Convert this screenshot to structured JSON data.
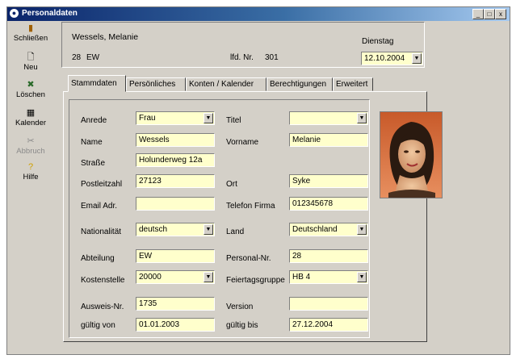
{
  "window": {
    "title": "Personaldaten",
    "buttons": [
      "_",
      "□",
      "x"
    ]
  },
  "toolbar": [
    {
      "label": "Schließen",
      "icon": "door-icon",
      "glyph": "▮",
      "color": "#a06000",
      "enabled": true
    },
    {
      "label": "Neu",
      "icon": "new-document-icon",
      "glyph": "🗋",
      "color": "#000000",
      "enabled": true
    },
    {
      "label": "Löschen",
      "icon": "delete-icon",
      "glyph": "✖",
      "color": "#2a6a2a",
      "enabled": true
    },
    {
      "label": "Kalender",
      "icon": "calendar-icon",
      "glyph": "▦",
      "color": "#000000",
      "enabled": true
    },
    {
      "label": "Abbruch",
      "icon": "cancel-icon",
      "glyph": "✂",
      "color": "#8a8a8a",
      "enabled": false
    },
    {
      "label": "Hilfe",
      "icon": "help-icon",
      "glyph": "?",
      "color": "#d0a000",
      "enabled": true
    }
  ],
  "header": {
    "name": "Wessels, Melanie",
    "dept_number": "28",
    "dept_code": "EW",
    "lfd_label": "lfd. Nr.",
    "lfd_value": "301",
    "weekday": "Dienstag",
    "date": "12.10.2004"
  },
  "tabs": [
    "Stammdaten",
    "Persönliches",
    "Konten / Kalender",
    "Berechtigungen",
    "Erweitert"
  ],
  "active_tab": 0,
  "form": {
    "anrede": {
      "label": "Anrede",
      "value": "Frau"
    },
    "titel": {
      "label": "Titel",
      "value": ""
    },
    "name": {
      "label": "Name",
      "value": "Wessels"
    },
    "vorname": {
      "label": "Vorname",
      "value": "Melanie"
    },
    "strasse": {
      "label": "Straße",
      "value": "Holunderweg 12a"
    },
    "plz": {
      "label": "Postleitzahl",
      "value": "27123"
    },
    "ort": {
      "label": "Ort",
      "value": "Syke"
    },
    "email": {
      "label": "Email Adr.",
      "value": ""
    },
    "telefon": {
      "label": "Telefon Firma",
      "value": "012345678"
    },
    "nationalitaet": {
      "label": "Nationalität",
      "value": "deutsch"
    },
    "land": {
      "label": "Land",
      "value": "Deutschland"
    },
    "abteilung": {
      "label": "Abteilung",
      "value": "EW"
    },
    "personalnr": {
      "label": "Personal-Nr.",
      "value": "28"
    },
    "kostenstelle": {
      "label": "Kostenstelle",
      "value": "20000"
    },
    "feiertag": {
      "label": "Feiertagsgruppe",
      "value": "HB 4"
    },
    "ausweis": {
      "label": "Ausweis-Nr.",
      "value": "1735"
    },
    "version": {
      "label": "Version",
      "value": ""
    },
    "gueltig_von": {
      "label": "gültig von",
      "value": "01.01.2003"
    },
    "gueltig_bis": {
      "label": "gültig bis",
      "value": "27.12.2004"
    }
  },
  "colors": {
    "field_bg": "#ffffcc",
    "dialog_bg": "#d4d0c8",
    "title_start": "#0a246a",
    "title_end": "#a6caf0"
  }
}
